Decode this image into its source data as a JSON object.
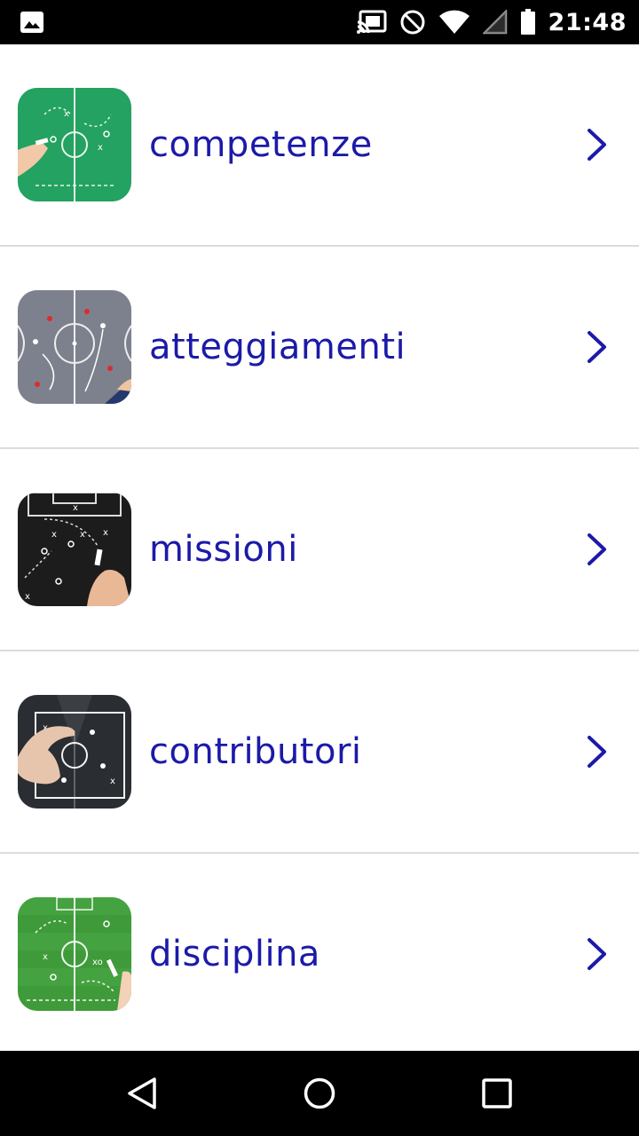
{
  "status_bar": {
    "time": "21:48",
    "icons": [
      "image-notification-icon",
      "cast-icon",
      "do-not-disturb-icon",
      "wifi-icon",
      "cell-signal-icon",
      "battery-icon"
    ]
  },
  "menu": {
    "items": [
      {
        "label": "competenze",
        "thumb_style": "green-board-hand"
      },
      {
        "label": "atteggiamenti",
        "thumb_style": "grey-board"
      },
      {
        "label": "missioni",
        "thumb_style": "black-board-hand"
      },
      {
        "label": "contributori",
        "thumb_style": "glass-board-hand"
      },
      {
        "label": "disciplina",
        "thumb_style": "green-board-chalk"
      }
    ],
    "chevron_icon": "chevron-right-icon"
  },
  "nav_bar": {
    "icons": [
      "back-icon",
      "home-icon",
      "recents-icon"
    ]
  },
  "colors": {
    "label": "#1c1aa8",
    "chevron": "#1c1aa8",
    "divider": "#dcdcdc",
    "status_bar_bg": "#000000",
    "nav_bar_bg": "#000000"
  }
}
